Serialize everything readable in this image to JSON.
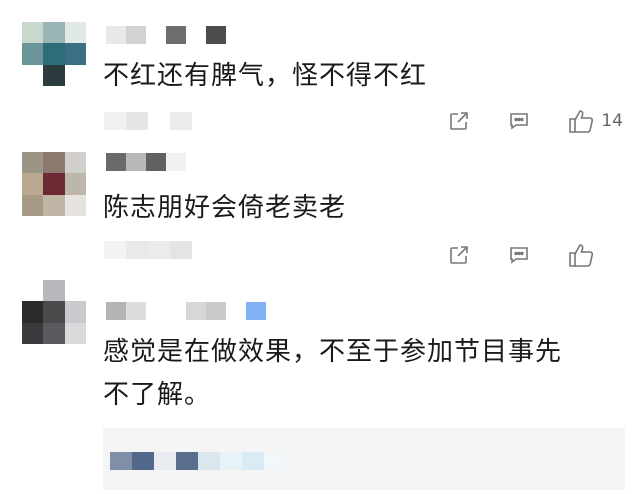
{
  "comments": [
    {
      "text": "不红还有脾气，怪不得不红",
      "likes": "14",
      "avatar_colors": [
        "#c9d8cc",
        "#9ab5b6",
        "#e2e9e5",
        "#6b9599",
        "#2d6d7a",
        "#3c6e85",
        "#ffffff",
        "#2b3b3e",
        "#ffffff"
      ],
      "name_colors": [
        "#e8e8e8",
        "#d2d2d2",
        "#ffffff",
        "#6e6e6e",
        "#ffffff",
        "#4c4c4c"
      ],
      "meta_colors": [
        "#f1f1f1",
        "#e6e6e6",
        "#ffffff",
        "#ebebeb"
      ]
    },
    {
      "text": "陈志朋好会倚老卖老",
      "likes": "",
      "avatar_colors": [
        "#9c9586",
        "#8a7a6e",
        "#d1cfcb",
        "#b8a990",
        "#6e2a34",
        "#bdb7ab",
        "#a89a84",
        "#c0b6a6",
        "#e6e3df"
      ],
      "name_colors": [
        "#6a6a6a",
        "#b9b9b9",
        "#616161",
        "#f1f1f1"
      ],
      "meta_colors": [
        "#f3f3f3",
        "#e9e9e9",
        "#ebebeb",
        "#e4e4e4"
      ]
    },
    {
      "text": "感觉是在做效果，不至于参加节目事先不了解。",
      "text_line1": "感觉是在做效果，不至于参加节目事先",
      "text_line2": "不了解。",
      "avatar_colors": [
        "#ffffff",
        "#b7b9bf",
        "#ffffff",
        "#2d2a2c",
        "#4d4a4d",
        "#c8cacd",
        "#3a3a3d",
        "#5a5a5e",
        "#d9d9db"
      ],
      "name_colors": [
        "#b4b4b4",
        "#dcdcdc",
        "#ffffff",
        "#ffffff",
        "#d7d7d7",
        "#cbcbcb",
        "#ffffff",
        "#7fb3f5"
      ],
      "reply_colors": [
        "#7f8fa8",
        "#52688a",
        "#e8ecf1",
        "#5a6f8e",
        "#dbe6ef",
        "#e8f3f8",
        "#d9ecf6",
        "#f2f7fa"
      ]
    }
  ],
  "icons": {
    "share": "share-icon",
    "comment": "comment-icon",
    "like": "thumbs-up-icon"
  }
}
